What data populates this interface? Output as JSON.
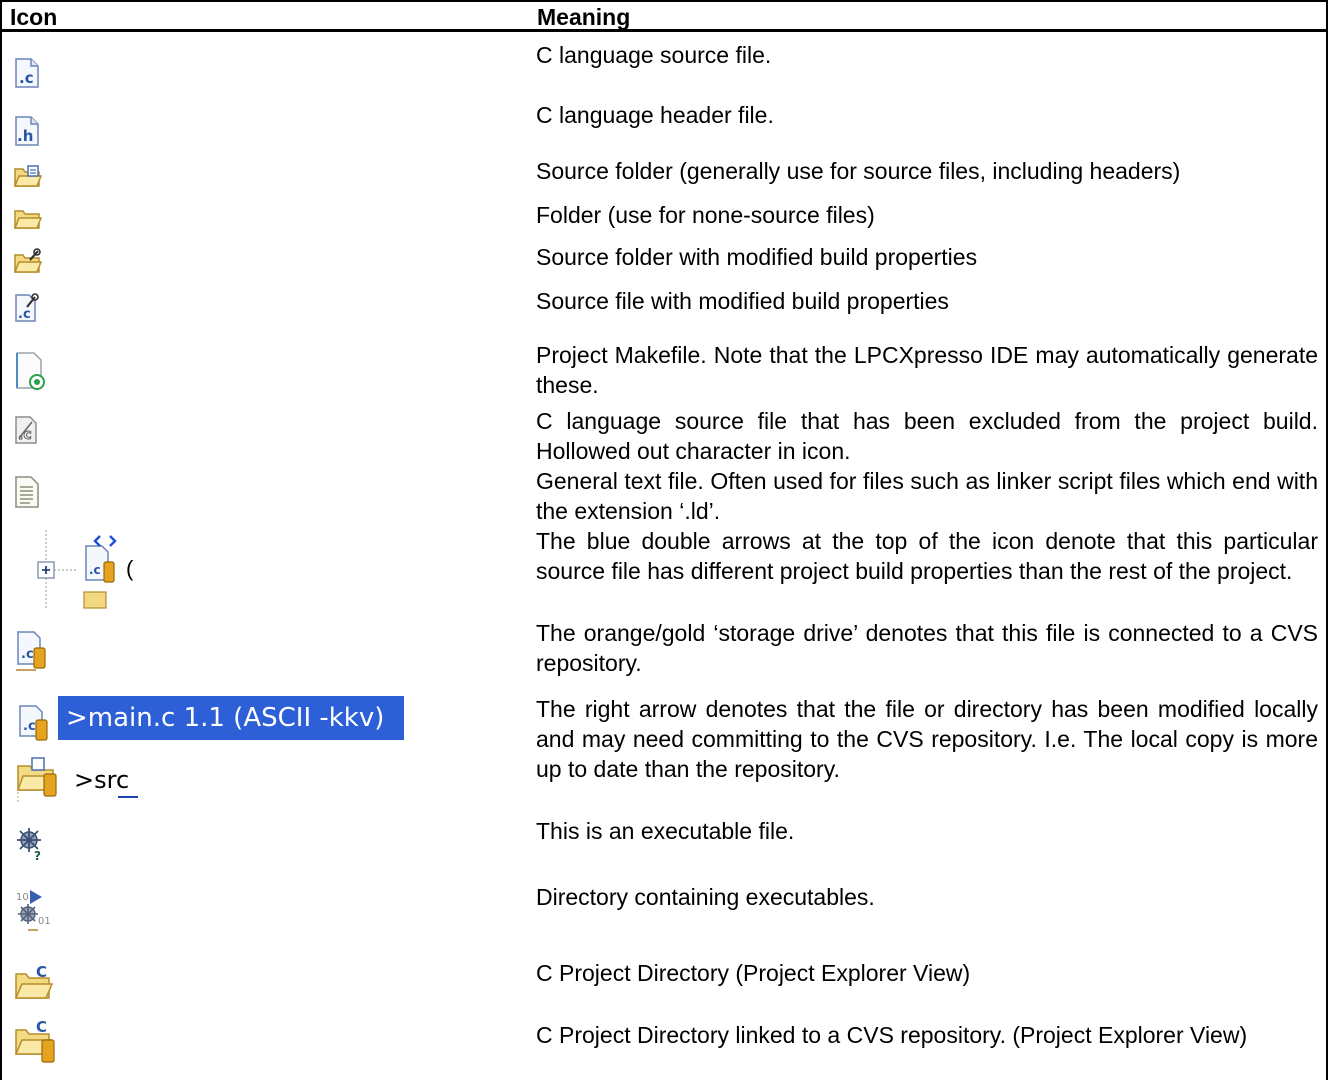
{
  "header": {
    "icon": "Icon",
    "meaning": "Meaning"
  },
  "rows": [
    {
      "icon": "c-source-file-icon",
      "meaning": "C language source file."
    },
    {
      "icon": "c-header-file-icon",
      "meaning": "C language header file."
    },
    {
      "icon": "source-folder-icon",
      "meaning": "Source folder (generally use for source files, including headers)"
    },
    {
      "icon": "folder-icon",
      "meaning": "Folder (use for none-source files)"
    },
    {
      "icon": "source-folder-modified-icon",
      "meaning": "Source folder with modified build properties"
    },
    {
      "icon": "source-file-modified-icon",
      "meaning": "Source file with modified build properties"
    },
    {
      "icon": "makefile-icon",
      "meaning": "Project Makefile. Note that the LPCXpresso IDE may automatically generate these."
    },
    {
      "icon": "excluded-source-file-icon",
      "meaning": "C language source file that has been excluded from the project build. Hollowed out character in icon."
    },
    {
      "icon": "text-file-icon",
      "meaning": "General text file. Often used for files such as linker script files which end with the extension ‘.ld’."
    },
    {
      "icon": "different-build-properties-icon",
      "meaning": "The blue double arrows at the top of the icon denote that this particular source file has different project build properties than the rest of the project.",
      "tree_fragment": "("
    },
    {
      "icon": "cvs-file-icon",
      "meaning": "The orange/gold ‘storage drive’ denotes that this file is connected to a CVS repository."
    },
    {
      "icon": "cvs-modified-icon",
      "meaning": "The right arrow denotes that the file or directory has been modified locally and may need committing to the CVS repository. I.e. The local copy is more up to date than the repository.",
      "file_label": ">main.c  1.1  (ASCII -kkv)",
      "folder_label": ">src"
    },
    {
      "icon": "executable-file-icon",
      "meaning": "This is an executable file."
    },
    {
      "icon": "executables-directory-icon",
      "meaning": "Directory containing executables."
    },
    {
      "icon": "c-project-directory-icon",
      "meaning": "C Project Directory (Project Explorer View)"
    },
    {
      "icon": "c-project-cvs-directory-icon",
      "meaning": "C Project Directory linked to a CVS repository. (Project Explorer View)"
    }
  ]
}
